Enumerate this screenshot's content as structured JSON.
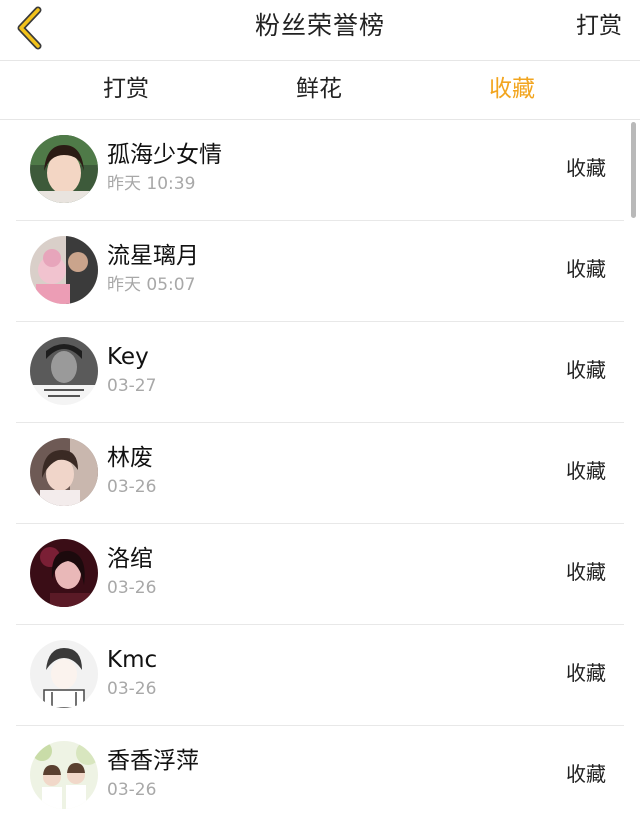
{
  "header": {
    "title": "粉丝荣誉榜",
    "action_label": "打赏",
    "back_icon": "chevron-left-icon",
    "accent_color": "#f2a51f"
  },
  "tabs": [
    {
      "label": "打赏",
      "active": false
    },
    {
      "label": "鲜花",
      "active": false
    },
    {
      "label": "收藏",
      "active": true
    }
  ],
  "list": {
    "items": [
      {
        "name": "孤海少女情",
        "time": "昨天 10:39",
        "action": "收藏"
      },
      {
        "name": "流星璃月",
        "time": "昨天 05:07",
        "action": "收藏"
      },
      {
        "name": "Key",
        "time": "03-27",
        "action": "收藏"
      },
      {
        "name": "林废",
        "time": "03-26",
        "action": "收藏"
      },
      {
        "name": "洛绾",
        "time": "03-26",
        "action": "收藏"
      },
      {
        "name": "Kmc",
        "time": "03-26",
        "action": "收藏"
      },
      {
        "name": "香香浮萍",
        "time": "03-26",
        "action": "收藏"
      }
    ]
  }
}
